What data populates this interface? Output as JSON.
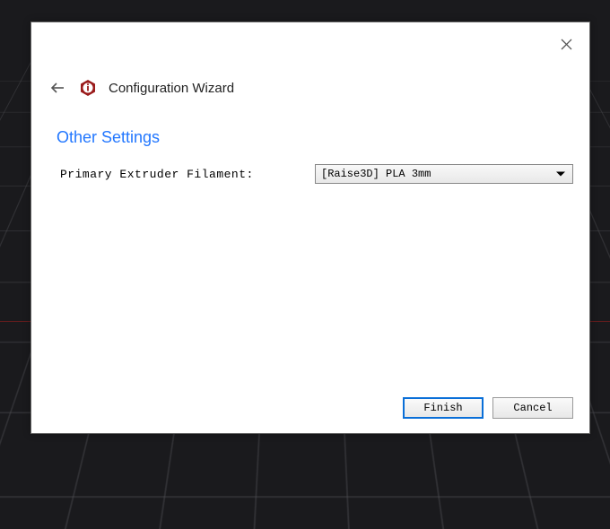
{
  "dialog": {
    "title": "Configuration Wizard",
    "section_title": "Other Settings"
  },
  "form": {
    "filament_label": "Primary Extruder Filament:",
    "filament_value": "[Raise3D] PLA 3mm"
  },
  "buttons": {
    "finish": "Finish",
    "cancel": "Cancel"
  },
  "colors": {
    "accent": "#2277ff",
    "primary_border": "#0a6fd8",
    "icon_red": "#9a1b1b"
  }
}
